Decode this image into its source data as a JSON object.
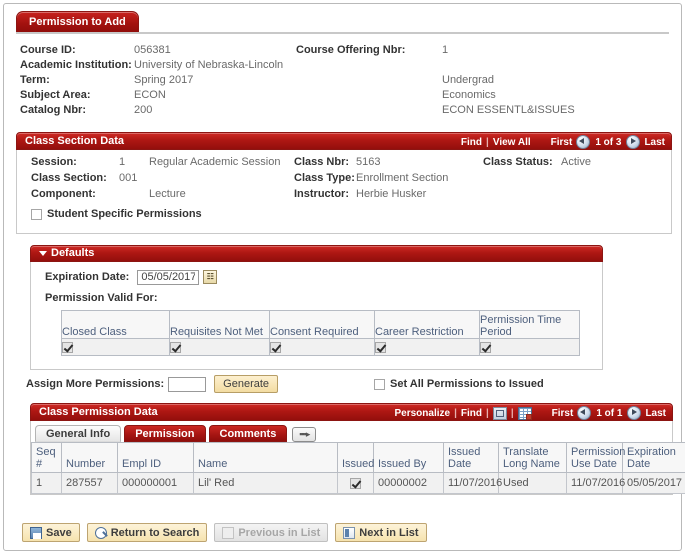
{
  "page_tab": {
    "label": "Permission to Add"
  },
  "key_fields": [
    {
      "label": "Course ID:",
      "value": "056381",
      "label2": "Course Offering Nbr:",
      "value2": "1"
    },
    {
      "label": "Academic Institution:",
      "value": "University of Nebraska-Lincoln",
      "label2": "",
      "value2": ""
    },
    {
      "label": "Term:",
      "value": "Spring 2017",
      "label2": "",
      "value2": "Undergrad"
    },
    {
      "label": "Subject Area:",
      "value": "ECON",
      "label2": "",
      "value2": "Economics"
    },
    {
      "label": "Catalog Nbr:",
      "value": "200",
      "label2": "",
      "value2": "ECON ESSENTL&ISSUES"
    }
  ],
  "class_section": {
    "title": "Class Section Data",
    "find_label": "Find",
    "view_all_label": "View All",
    "first_label": "First",
    "last_label": "Last",
    "counter": "1 of 3",
    "prev_icon": "prev-arrow-icon",
    "next_icon": "next-arrow-icon",
    "rows": [
      {
        "l1": "Session:",
        "v1": "1",
        "v1b": "Regular Academic Session",
        "l2": "Class Nbr:",
        "v2": "5163",
        "l3": "Class Status:",
        "v3": "Active"
      },
      {
        "l1": "Class Section:",
        "v1": "001",
        "v1b": "",
        "l2": "Class Type:",
        "v2": "Enrollment Section",
        "l3": "",
        "v3": ""
      },
      {
        "l1": "Component:",
        "v1": "",
        "v1b": "Lecture",
        "l2": "Instructor:",
        "v2": "Herbie Husker",
        "l3": "",
        "v3": ""
      }
    ],
    "student_specific_label": "Student Specific Permissions",
    "student_specific_checked": false
  },
  "defaults": {
    "title": "Defaults",
    "collapse_icon": "collapse-triangle-icon",
    "expiration_label": "Expiration Date:",
    "expiration_value": "05/05/2017",
    "calendar_icon": "calendar-icon",
    "valid_for_label": "Permission Valid For:",
    "columns": [
      "Closed Class",
      "Requisites Not Met",
      "Consent Required",
      "Career Restriction",
      "Permission Time Period"
    ],
    "checked": [
      true,
      true,
      true,
      true,
      true
    ]
  },
  "assign": {
    "label": "Assign More Permissions:",
    "value": "",
    "generate_label": "Generate",
    "set_all_label": "Set All Permissions to Issued",
    "set_all_checked": false
  },
  "class_permission": {
    "title": "Class Permission Data",
    "personalize_label": "Personalize",
    "find_label": "Find",
    "expand_icon": "expand-view-icon",
    "grid_icon": "download-spreadsheet-icon",
    "first_label": "First",
    "last_label": "Last",
    "counter": "1 of 1",
    "tabs": [
      {
        "label": "General Info",
        "active": true
      },
      {
        "label": "Permission",
        "active": false
      },
      {
        "label": "Comments",
        "active": false
      }
    ],
    "tab_expand_icon": "expand-tabs-icon",
    "columns": [
      "Seq #",
      "Number",
      "Empl ID",
      "Name",
      "Issued",
      "Issued By",
      "Issued Date",
      "Translate Long Name",
      "Permission Use Date",
      "Expiration Date",
      ""
    ],
    "rows": [
      {
        "seq": "1",
        "number": "287557",
        "empl_id": "000000001",
        "name": "Lil' Red",
        "issued": true,
        "issued_by": "00000002",
        "issued_date": "11/07/2016",
        "translate_long_name": "Used",
        "permission_use_date": "11/07/2016",
        "expiration_date": "05/05/2017",
        "delete_icon": "minus-delete-row-icon"
      }
    ]
  },
  "toolbar": [
    {
      "label": "Save",
      "icon": "save-disk-icon",
      "disabled": false
    },
    {
      "label": "Return to Search",
      "icon": "search-return-icon",
      "disabled": false
    },
    {
      "label": "Previous in List",
      "icon": "previous-in-list-icon",
      "disabled": true
    },
    {
      "label": "Next in List",
      "icon": "next-in-list-icon",
      "disabled": false
    }
  ],
  "colors": {
    "brand_red": "#a51512",
    "header_text": "#4d5f7d",
    "gold_button": "#f3dca2"
  }
}
